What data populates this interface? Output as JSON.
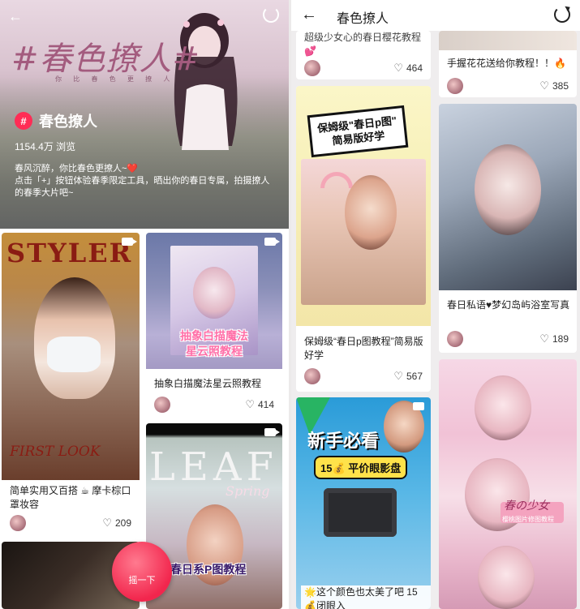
{
  "left": {
    "hero": {
      "logo": "#春色撩人#",
      "logo_sub": "你 比 春 色 更 撩 人",
      "topic_hash": "#",
      "topic_name": "春色撩人",
      "views": "1154.4万 浏览",
      "description": "春风沉醉，你比春色更撩人~❤️\n点击「+」按钮体验春季限定工具，晒出你的春日专属，拍摄撩人的春季大片吧~"
    },
    "cards": [
      {
        "overlay_top": "STYLER",
        "overlay_bottom": "FIRST LOOK",
        "title": "简单实用又百搭 ☕ 摩卡棕口罩妆容",
        "likes": "209"
      },
      {
        "overlay": "抽象白描魔法\n星云照教程",
        "title": "抽象白描魔法星云照教程",
        "likes": "414"
      },
      {
        "overlay_top": "LEAF",
        "overlay_spring": "Spring",
        "overlay": "春日系P图教程"
      }
    ],
    "fab_label": "摇一下"
  },
  "right": {
    "topbar": {
      "title": "春色撩人"
    },
    "cards": [
      {
        "title": "超级少女心的春日樱花教程💕",
        "likes": "464"
      },
      {
        "title": "手握花花送给你教程！！🔥",
        "likes": "385"
      },
      {
        "banner": "保姆级\"春日p图\"\n简易版好学",
        "title": "保姆级“春日p图教程”简易版好学",
        "likes": "567"
      },
      {
        "title": "春日私语♥梦幻岛屿浴室写真",
        "likes": "189"
      },
      {
        "headline": "新手必看",
        "sub": "15💰 平价眼影盘",
        "title": "🌟这个颜色也太美了吧 15💰闭眼入"
      },
      {
        "cap": "春の少女",
        "cap2": "樱桃图片修图教程"
      }
    ]
  }
}
